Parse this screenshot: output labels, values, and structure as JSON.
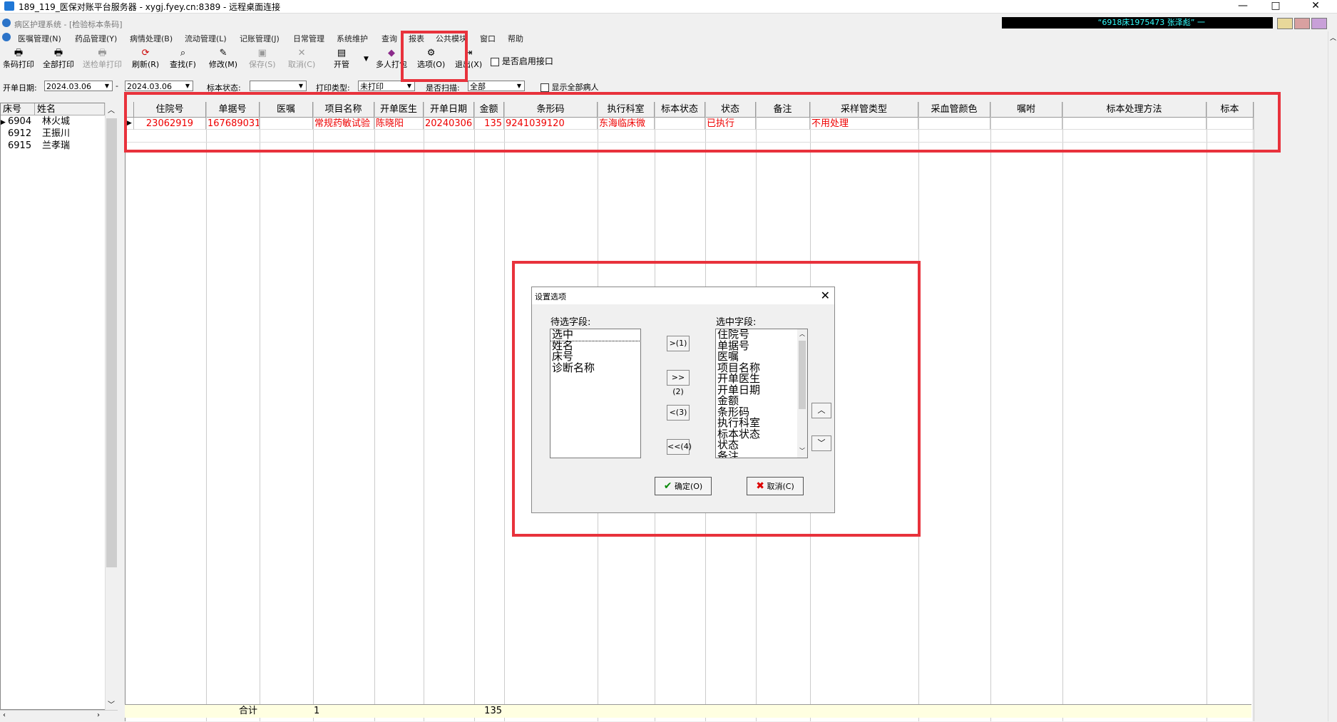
{
  "window": {
    "title": "189_119_医保对账平台服务器 - xygj.fyey.cn:8389 - 远程桌面连接",
    "min": "—",
    "max": "□",
    "close": "✕"
  },
  "banner": {
    "text": "“6918床1975473 张泽彪” 一"
  },
  "app": {
    "title": "病区护理系统 - [检验标本条码]"
  },
  "menu": [
    "医嘱管理(N)",
    "药品管理(Y)",
    "病情处理(B)",
    "流动管理(L)",
    "记账管理(J)",
    "日常管理",
    "系统维护",
    "查询",
    "报表",
    "公共模块",
    "窗口",
    "帮助"
  ],
  "toolbar": {
    "barcode_print": "条码打印",
    "print_all": "全部打印",
    "send_print": "送检单打印",
    "refresh": "刷新(R)",
    "find": "查找(F)",
    "modify": "修改(M)",
    "save": "保存(S)",
    "cancel": "取消(C)",
    "open_tube": "开管",
    "multi_print": "多人打包",
    "options": "选项(O)",
    "exit": "退出(X)",
    "enable_interface": "是否启用接口"
  },
  "filters": {
    "date_label": "开单日期:",
    "date_from": "2024.03.06",
    "date_sep": "-",
    "date_to": "2024.03.06",
    "specimen_status_label": "标本状态:",
    "specimen_status_value": "",
    "print_type_label": "打印类型:",
    "print_type_value": "未打印",
    "scanned_label": "是否扫描:",
    "scanned_value": "全部",
    "show_all_label": "显示全部病人"
  },
  "patients": {
    "headers": [
      "床号",
      "姓名"
    ],
    "rows": [
      {
        "bed": "6904",
        "name": "林火城"
      },
      {
        "bed": "6912",
        "name": "王振川"
      },
      {
        "bed": "6915",
        "name": "兰孝瑞"
      }
    ]
  },
  "grid": {
    "headers": [
      "住院号",
      "单据号",
      "医嘱",
      "项目名称",
      "开单医生",
      "开单日期",
      "金额",
      "条形码",
      "执行科室",
      "标本状态",
      "状态",
      "备注",
      "采样管类型",
      "采血管颜色",
      "嘱咐",
      "标本处理方法",
      "标本"
    ],
    "row": [
      "23062919",
      "167689031",
      "",
      "常规药敏试验",
      "陈晓阳",
      "20240306",
      "135",
      "9241039120",
      "东海临床微",
      "",
      "已执行",
      "",
      "不用处理",
      "",
      "",
      "",
      ""
    ],
    "footer": {
      "label": "合计",
      "count": "1",
      "amount": "135"
    }
  },
  "dialog": {
    "title": "设置选项",
    "available_label": "待选字段:",
    "available": [
      "选中",
      "姓名",
      "床号",
      "诊断名称"
    ],
    "selected_label": "选中字段:",
    "selected": [
      "住院号",
      "单据号",
      "医嘱",
      "项目名称",
      "开单医生",
      "开单日期",
      "金额",
      "条形码",
      "执行科室",
      "标本状态",
      "状态",
      "备注"
    ],
    "move_one_right": ">(1)",
    "move_all_right": ">>(2)",
    "move_one_left": "<(3)",
    "move_all_left": "<<(4)",
    "up": "︿",
    "down": "﹀",
    "ok": "确定(O)",
    "cancel": "取消(C)"
  }
}
